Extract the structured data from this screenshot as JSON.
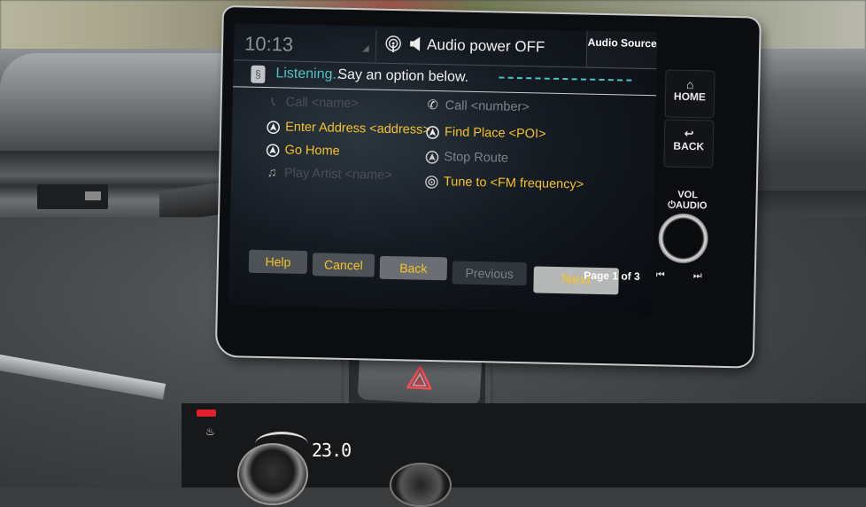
{
  "status_bar": {
    "time": "10:13",
    "audio_status": "Audio power OFF",
    "audio_source_button": "Audio Source",
    "icons": [
      "signal-icon",
      "dab-radio-icon",
      "speaker-icon"
    ]
  },
  "voice_bar": {
    "icon": "voice-command-icon",
    "listening_label": "Listening...",
    "prompt": "Say an option below."
  },
  "options": [
    {
      "icon": "phone-icon",
      "label": "Call <name>",
      "state": "faint"
    },
    {
      "icon": "navigation-icon",
      "label": "Enter Address <address>",
      "state": "active"
    },
    {
      "icon": "navigation-icon",
      "label": "Go Home",
      "state": "active"
    },
    {
      "icon": "music-note-icon",
      "label": "Play Artist <name>",
      "state": "faint"
    },
    {
      "icon": "phone-icon",
      "label": "Call <number>",
      "state": "dim"
    },
    {
      "icon": "navigation-icon",
      "label": "Find Place <POI>",
      "state": "active"
    },
    {
      "icon": "navigation-icon",
      "label": "Stop Route",
      "state": "dim"
    },
    {
      "icon": "radio-icon",
      "label": "Tune to <FM frequency>",
      "state": "active"
    }
  ],
  "bottom_bar": {
    "help": "Help",
    "cancel": "Cancel",
    "back": "Back",
    "previous": "Previous",
    "next": "Next",
    "page_indicator": "Page 1 of 3"
  },
  "hardware": {
    "home": "HOME",
    "back": "BACK",
    "vol_line1": "VOL",
    "vol_line2": "AUDIO",
    "prev_track": "⏮",
    "next_track": "⏭"
  },
  "climate": {
    "temperature": "23.0"
  },
  "colors": {
    "accent_yellow": "#f4c22b",
    "listening_teal": "#4ec2c4",
    "hazard_red": "#e8303a"
  }
}
